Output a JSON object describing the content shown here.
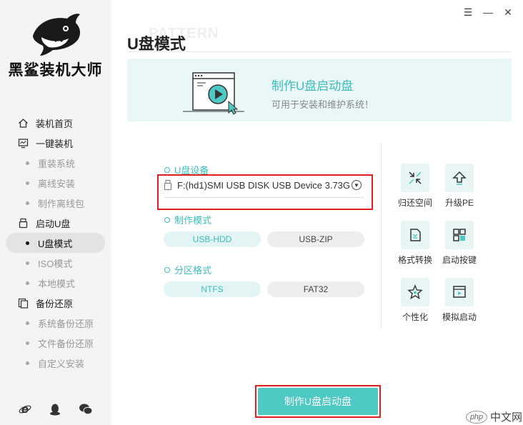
{
  "app": {
    "brand": "黑鲨装机大师"
  },
  "window_controls": {
    "menu": "☰",
    "minimize": "—",
    "close": "✕"
  },
  "header": {
    "background_word": "PATTERN",
    "title": "U盘模式"
  },
  "banner": {
    "title": "制作U盘启动盘",
    "subtitle": "可用于安装和维护系统！"
  },
  "sidebar": {
    "groups": [
      {
        "label": "装机首页",
        "icon": "home-icon"
      },
      {
        "label": "一键装机",
        "icon": "monitor-icon",
        "items": [
          "重装系统",
          "离线安装",
          "制作离线包"
        ]
      },
      {
        "label": "启动U盘",
        "icon": "usb-icon",
        "items": [
          "U盘模式",
          "ISO模式",
          "本地模式"
        ]
      },
      {
        "label": "备份还原",
        "icon": "backup-icon",
        "items": [
          "系统备份还原",
          "文件备份还原",
          "自定义安装"
        ]
      }
    ],
    "active_item": "U盘模式"
  },
  "form": {
    "device_label": "U盘设备",
    "device_value": "F:(hd1)SMI USB DISK USB Device 3.73GB",
    "mode_label": "制作模式",
    "mode_options": [
      "USB-HDD",
      "USB-ZIP"
    ],
    "mode_selected": "USB-HDD",
    "partition_label": "分区格式",
    "partition_options": [
      "NTFS",
      "FAT32"
    ],
    "partition_selected": "NTFS"
  },
  "tools": [
    {
      "label": "归还空间",
      "icon": "shrink-icon"
    },
    {
      "label": "升级PE",
      "icon": "upgrade-icon"
    },
    {
      "label": "格式转换",
      "icon": "convert-icon"
    },
    {
      "label": "启动按键",
      "icon": "keys-icon"
    },
    {
      "label": "个性化",
      "icon": "star-icon"
    },
    {
      "label": "模拟启动",
      "icon": "simulate-icon"
    }
  ],
  "start_button": "制作U盘启动盘",
  "watermark": {
    "logo": "php",
    "text": "中文网"
  },
  "colors": {
    "accent": "#3cbcbc",
    "button": "#4ec9c3",
    "highlight_border": "#e02020",
    "sidebar_bg": "#f4f4f4"
  }
}
